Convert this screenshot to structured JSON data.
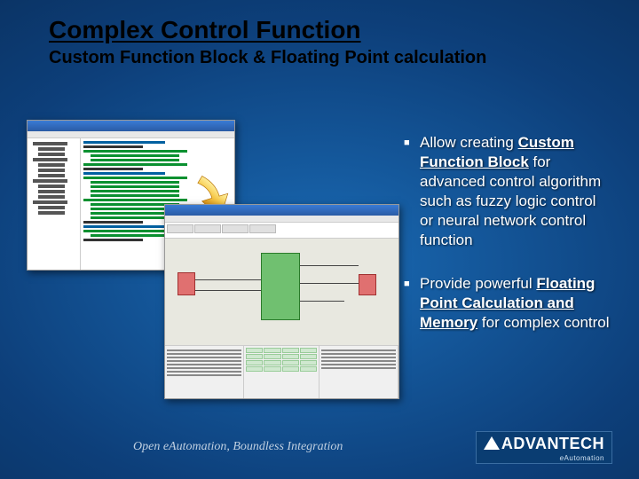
{
  "title": "Complex Control Function",
  "subtitle": "Custom Function Block & Floating Point calculation",
  "bullets": [
    {
      "pre": "Allow creating ",
      "bold": "Custom Function Block",
      "post": " for advanced control algorithm such as fuzzy logic control or neural network control function"
    },
    {
      "pre": "Provide powerful ",
      "bold": "Floating Point Calculation and Memory",
      "post": " for complex control"
    }
  ],
  "footer": {
    "tagline": "Open eAutomation, Boundless Integration",
    "brand": "ADVANTECH",
    "subbrand_e": "e",
    "subbrand_rest": "Automation"
  }
}
